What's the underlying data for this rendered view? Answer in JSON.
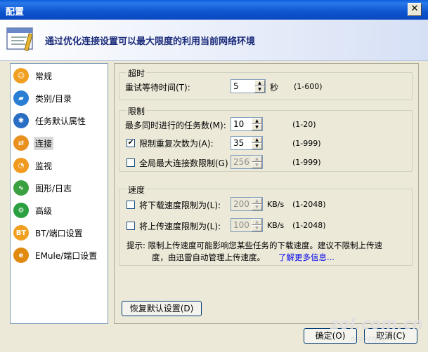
{
  "window": {
    "title": "配置",
    "close_glyph": "✕"
  },
  "banner": {
    "text": "通过优化连接设置可以最大限度的利用当前网络环境",
    "icon": "settings-panel-icon"
  },
  "nav": {
    "items": [
      {
        "label": "常规",
        "icon": "general-icon",
        "color": "#f0a020"
      },
      {
        "label": "类别/目录",
        "icon": "folder-icon",
        "color": "#2a7fd4"
      },
      {
        "label": "任务默认属性",
        "icon": "gear-icon",
        "color": "#2a6fc4"
      },
      {
        "label": "连接",
        "icon": "connection-icon",
        "color": "#e89020"
      },
      {
        "label": "监视",
        "icon": "monitor-icon",
        "color": "#f09a20"
      },
      {
        "label": "图形/日志",
        "icon": "chart-icon",
        "color": "#3aa040"
      },
      {
        "label": "高级",
        "icon": "advanced-icon",
        "color": "#2aa040"
      },
      {
        "label": "BT/端口设置",
        "icon": "bt-icon",
        "color": "#f0a020"
      },
      {
        "label": "EMule/端口设置",
        "icon": "emule-icon",
        "color": "#e08a10"
      }
    ],
    "selected_index": 3
  },
  "timeout": {
    "title": "超时",
    "retry_label": "重试等待时间(T):",
    "retry_value": "5",
    "retry_unit": "秒",
    "retry_range": "(1-600)"
  },
  "limits": {
    "title": "限制",
    "max_tasks_label": "最多同时进行的任务数(M):",
    "max_tasks_value": "10",
    "max_tasks_range": "(1-20)",
    "retry_limit_label": "限制重复次数为(A):",
    "retry_limit_checked": true,
    "retry_limit_value": "35",
    "retry_limit_range": "(1-999)",
    "global_conn_label": "全局最大连接数限制(G)",
    "global_conn_checked": false,
    "global_conn_value": "256",
    "global_conn_range": "(1-999)"
  },
  "speed": {
    "title": "速度",
    "download_label": "将下载速度限制为(L):",
    "download_checked": false,
    "download_value": "200",
    "download_unit": "KB/s",
    "download_range": "(1-2048)",
    "upload_label": "将上传速度限制为(L):",
    "upload_checked": false,
    "upload_value": "100",
    "upload_unit": "KB/s",
    "upload_range": "(1-2048)",
    "hint_line1": "提示: 限制上传速度可能影响您某些任务的下载速度。建议不限制上传速",
    "hint_line2": "度，由迅雷自动管理上传速度。",
    "hint_link": "了解更多信息..."
  },
  "buttons": {
    "restore": "恢复默认设置(D)",
    "ok": "确定(O)",
    "cancel": "取消(C)"
  },
  "watermark": "zol.com.cn",
  "watermark_sub": "中关村在线",
  "checkmark": "✔"
}
